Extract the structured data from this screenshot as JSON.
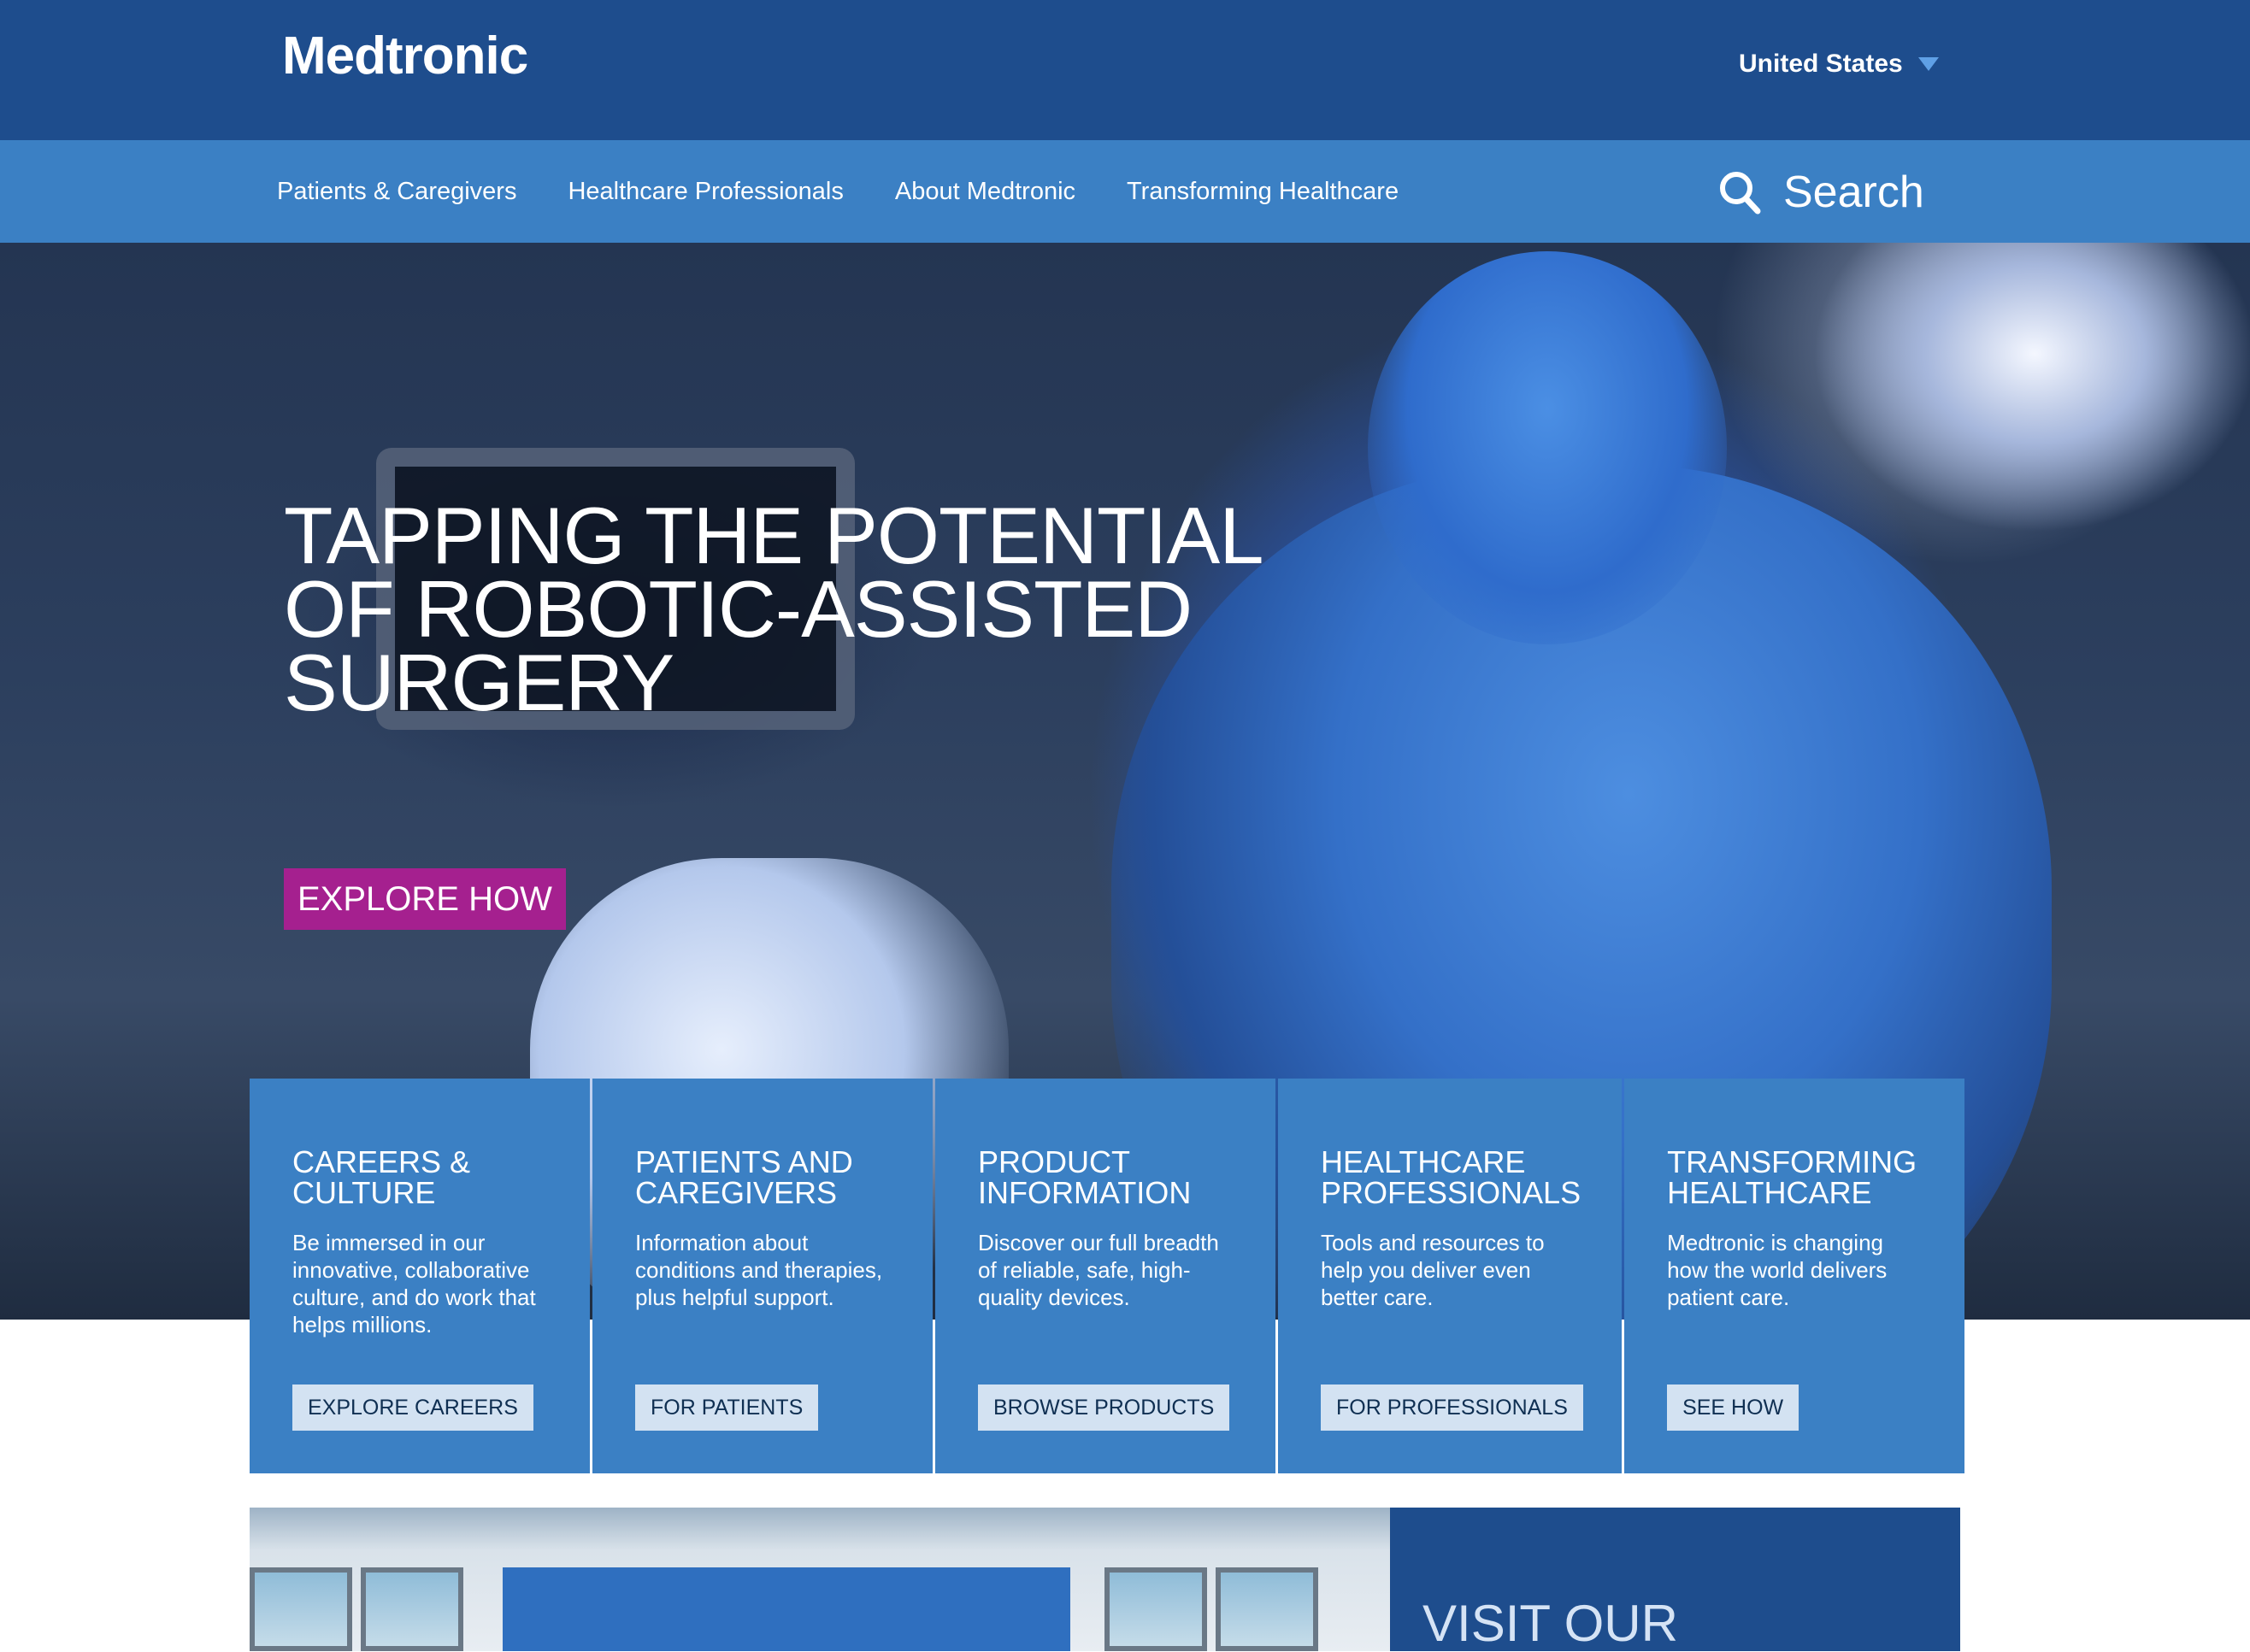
{
  "header": {
    "logo": "Medtronic",
    "country": "United States"
  },
  "nav": {
    "links": [
      "Patients & Caregivers",
      "Healthcare Professionals",
      "About Medtronic",
      "Transforming Healthcare"
    ],
    "search_label": "Search"
  },
  "hero": {
    "title": "TAPPING THE POTENTIAL OF ROBOTIC-ASSISTED SURGERY",
    "cta": "EXPLORE HOW"
  },
  "cards": [
    {
      "title": "CAREERS & CULTURE",
      "text": "Be immersed in our innovative, collaborative culture, and do work that helps millions.",
      "button": "EXPLORE CAREERS"
    },
    {
      "title": "PATIENTS AND CAREGIVERS",
      "text": "Information about conditions and therapies, plus helpful support.",
      "button": "FOR PATIENTS"
    },
    {
      "title": "PRODUCT INFORMATION",
      "text": "Discover our full breadth of reliable, safe, high-quality devices.",
      "button": "BROWSE PRODUCTS"
    },
    {
      "title": "HEALTHCARE PROFESSIONALS",
      "text": "Tools and resources to help you deliver even better care.",
      "button": "FOR PROFESSIONALS"
    },
    {
      "title": "TRANSFORMING HEALTHCARE",
      "text": "Medtronic is changing how the world delivers patient care.",
      "button": "SEE HOW"
    }
  ],
  "promo": {
    "title": "VISIT OUR"
  },
  "colors": {
    "header_bg": "#1e4d8d",
    "nav_bg": "#3b80c4",
    "cta_bg": "#a5208f",
    "card_btn_bg": "#d3e2f2"
  }
}
